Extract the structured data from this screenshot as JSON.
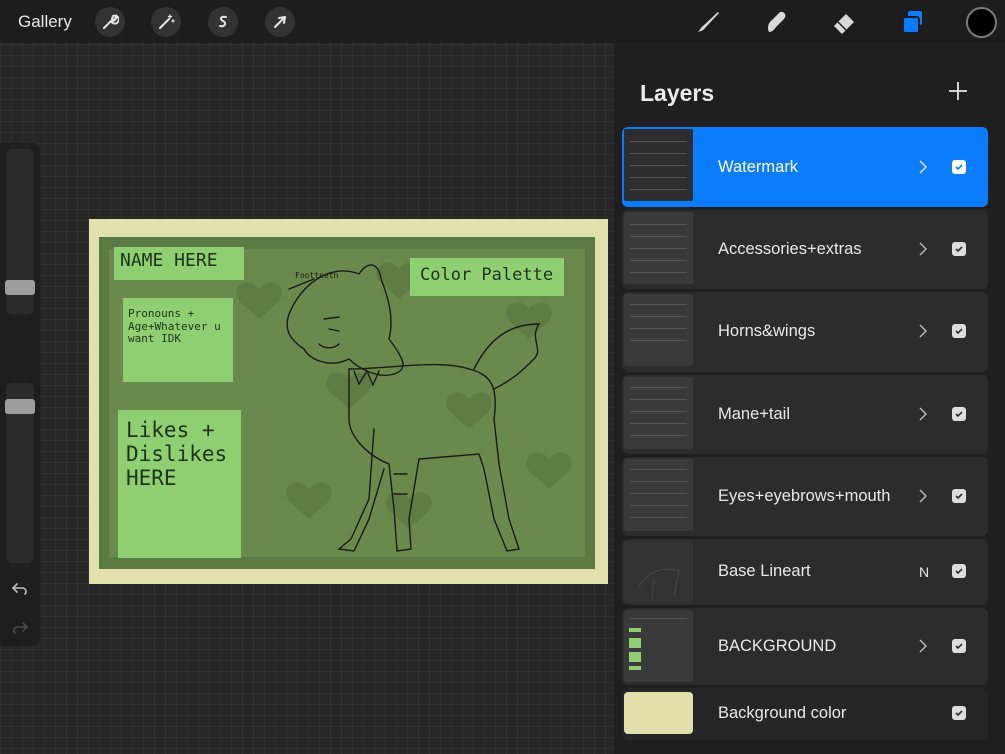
{
  "topbar": {
    "gallery_label": "Gallery",
    "left_tools": [
      {
        "icon": "wrench-icon",
        "name": "actions"
      },
      {
        "icon": "magic-wand-icon",
        "name": "adjustments"
      },
      {
        "icon": "selection-s-icon",
        "name": "selection"
      },
      {
        "icon": "arrow-cursor-icon",
        "name": "transform"
      }
    ],
    "right_tools": [
      {
        "icon": "brush-icon",
        "name": "paint"
      },
      {
        "icon": "smudge-icon",
        "name": "smudge"
      },
      {
        "icon": "eraser-icon",
        "name": "erase"
      },
      {
        "icon": "layers-icon",
        "name": "layers",
        "active": true
      }
    ],
    "current_color": "#000000",
    "accent_color": "#0a7cfd"
  },
  "canvas": {
    "name_label": "NAME HERE",
    "palette_label": "Color Palette",
    "pronouns_label": "Pronouns + Age+Whatever u want IDK",
    "likes_label": "Likes + Dislikes HERE",
    "character_tag": "Footteeth"
  },
  "layers": {
    "title": "Layers",
    "add_icon": "plus-icon",
    "items": [
      {
        "name": "Watermark",
        "group": true,
        "visible": true,
        "active": true
      },
      {
        "name": "Accessories+extras",
        "group": true,
        "visible": true
      },
      {
        "name": "Horns&wings",
        "group": true,
        "visible": true
      },
      {
        "name": "Mane+tail",
        "group": true,
        "visible": true
      },
      {
        "name": "Eyes+eyebrows+mouth",
        "group": true,
        "visible": true
      },
      {
        "name": "Base Lineart",
        "group": false,
        "blend_mode": "N",
        "visible": true
      },
      {
        "name": "BACKGROUND",
        "group": true,
        "visible": true
      },
      {
        "name": "Background color",
        "group": false,
        "visible": true,
        "color": "#e2dfaa"
      }
    ]
  }
}
